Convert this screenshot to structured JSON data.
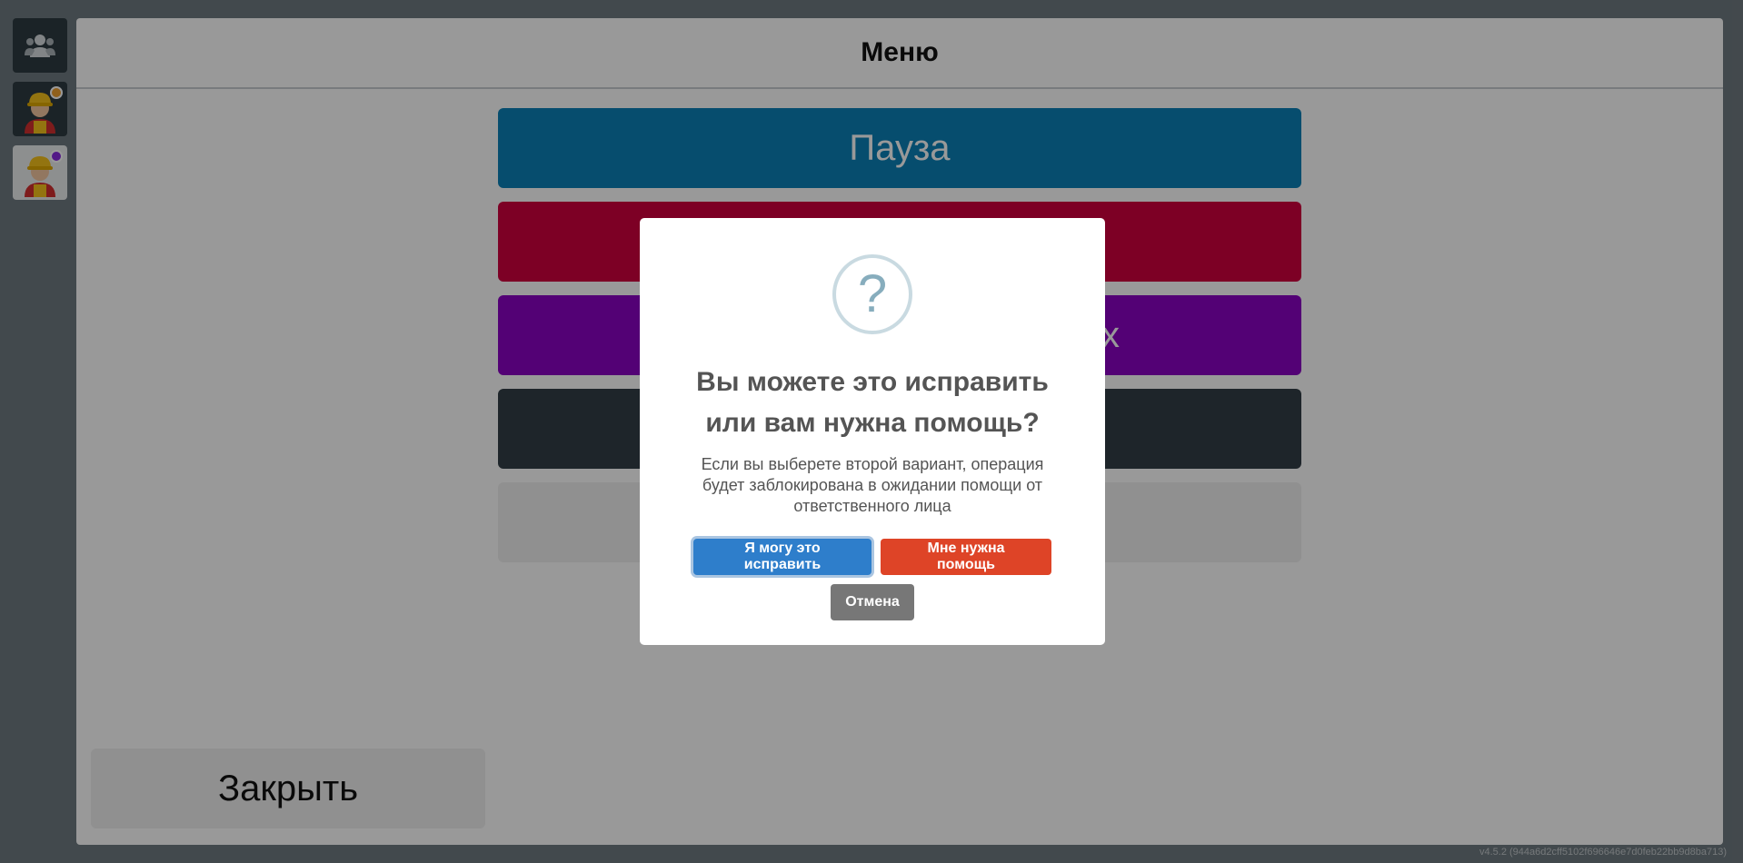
{
  "sidebar": {
    "items": [
      {
        "icon": "users-icon",
        "style": "dark"
      },
      {
        "icon": "worker-avatar-icon",
        "style": "dark",
        "badge_color": "#f0a030"
      },
      {
        "icon": "worker-avatar-icon",
        "style": "light",
        "badge_color": "#8a2be2"
      }
    ]
  },
  "header": {
    "title": "Меню"
  },
  "menu": {
    "items": [
      {
        "label": "Пауза",
        "color": "#0b81b7"
      },
      {
        "label": "",
        "color": "#d1013f"
      },
      {
        "label": "х",
        "color": "#8a02c4"
      },
      {
        "label": "",
        "color": "#323f46"
      },
      {
        "label": "",
        "color": "#f1f1f1"
      }
    ]
  },
  "close_label": "Закрыть",
  "version": "v4.5.2 (944a6d2cff5102f696646e7d0feb22bb9d8ba713)",
  "dialog": {
    "icon": "question-icon",
    "icon_glyph": "?",
    "title": "Вы можете это исправить или вам нужна помощь?",
    "text": "Если вы выберете второй вариант, операция будет заблокирована в ожидании помощи от ответственного лица",
    "buttons": {
      "fix": "Я могу это исправить",
      "help": "Мне нужна помощь",
      "cancel": "Отмена"
    }
  }
}
